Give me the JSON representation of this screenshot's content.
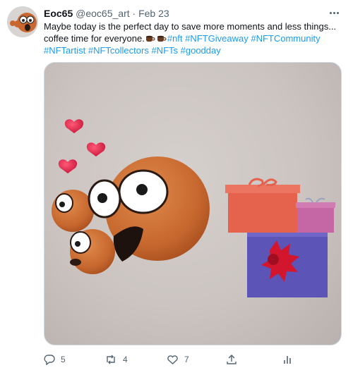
{
  "tweet": {
    "author_name": "Eoc65",
    "handle": "@eoc65_art",
    "separator": "·",
    "date": "Feb 23",
    "text_line1": "Maybe today is the perfect day to save more moments and less things...",
    "text_line2_prefix": "coffee time for everyone.",
    "hashtags_line2": [
      "#nft",
      "#NFTGiveaway",
      "#NFTCommunity"
    ],
    "hashtags_line3": [
      "#NFTartist",
      "#NFTcollectors",
      "#NFTs",
      "#goodday"
    ],
    "media_alt": "Orange emoji characters with hearts and gift boxes",
    "actions": {
      "reply_count": "5",
      "retweet_count": "4",
      "like_count": "7",
      "share_count": "",
      "analytics_count": ""
    }
  },
  "icons": {
    "more": "more-dots-icon",
    "reply": "reply-icon",
    "retweet": "retweet-icon",
    "like": "heart-icon",
    "share": "share-icon",
    "analytics": "analytics-icon"
  },
  "colors": {
    "link": "#1d9bf0",
    "muted": "#536471",
    "text": "#0f1419"
  }
}
